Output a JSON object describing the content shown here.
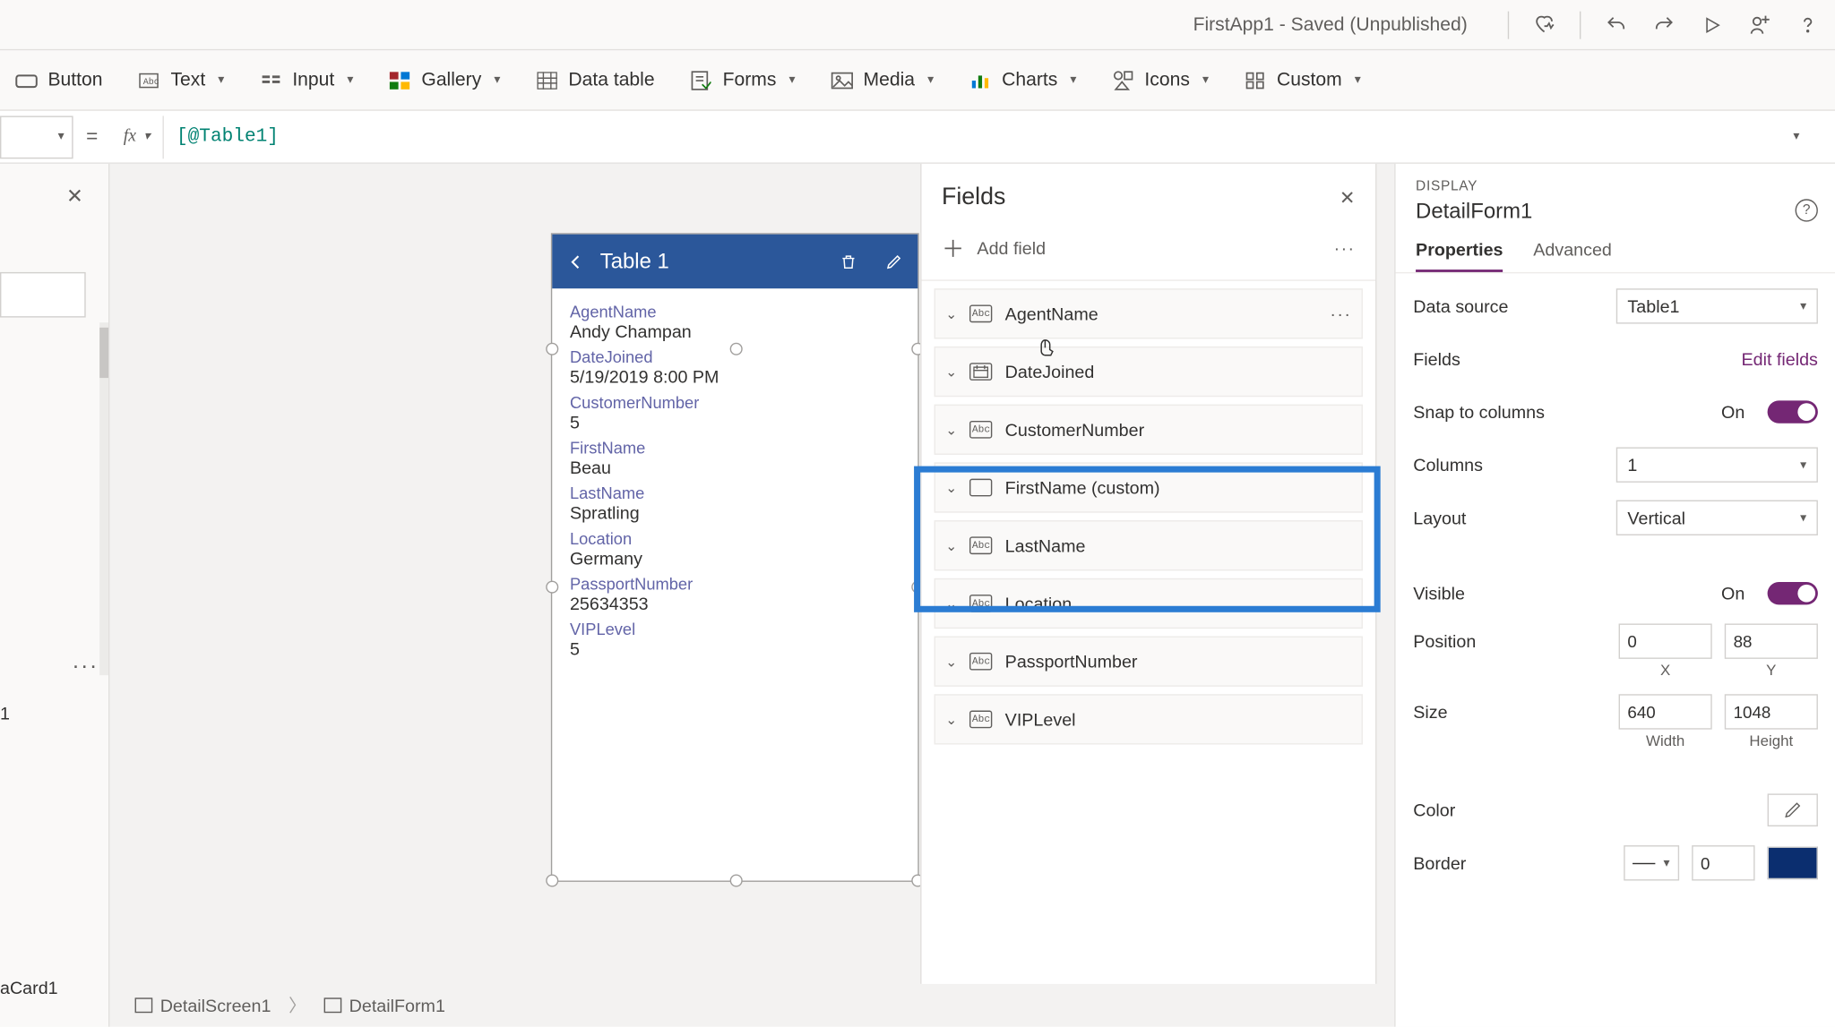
{
  "titlebar": {
    "app_title": "FirstApp1 - Saved (Unpublished)"
  },
  "ribbon": {
    "button": "Button",
    "text": "Text",
    "input": "Input",
    "gallery": "Gallery",
    "datatable": "Data table",
    "forms": "Forms",
    "media": "Media",
    "charts": "Charts",
    "icons": "Icons",
    "custom": "Custom"
  },
  "formula": {
    "eq": "=",
    "fx": "fx",
    "value": "[@Table1]"
  },
  "left": {
    "item1": "1",
    "item2": "aCard1"
  },
  "canvas_form": {
    "title": "Table 1",
    "fields": [
      {
        "label": "AgentName",
        "value": "Andy Champan"
      },
      {
        "label": "DateJoined",
        "value": "5/19/2019 8:00 PM"
      },
      {
        "label": "CustomerNumber",
        "value": "5"
      },
      {
        "label": "FirstName",
        "value": "Beau"
      },
      {
        "label": "LastName",
        "value": "Spratling"
      },
      {
        "label": "Location",
        "value": "Germany"
      },
      {
        "label": "PassportNumber",
        "value": "25634353"
      },
      {
        "label": "VIPLevel",
        "value": "5"
      }
    ]
  },
  "breadcrumbs": {
    "a": "DetailScreen1",
    "b": "DetailForm1"
  },
  "fields_panel": {
    "title": "Fields",
    "add": "Add field",
    "items": [
      {
        "name": "AgentName",
        "icon": "Abc",
        "dots": true
      },
      {
        "name": "DateJoined",
        "icon": "cal"
      },
      {
        "name": "CustomerNumber",
        "icon": "Abc"
      },
      {
        "name": "FirstName (custom)",
        "icon": "box"
      },
      {
        "name": "LastName",
        "icon": "Abc"
      },
      {
        "name": "Location",
        "icon": "Abc"
      },
      {
        "name": "PassportNumber",
        "icon": "Abc"
      },
      {
        "name": "VIPLevel",
        "icon": "Abc"
      }
    ]
  },
  "props": {
    "display": "DISPLAY",
    "name": "DetailForm1",
    "tabs": {
      "properties": "Properties",
      "advanced": "Advanced"
    },
    "datasource_lbl": "Data source",
    "datasource_val": "Table1",
    "fields_lbl": "Fields",
    "edit_fields": "Edit fields",
    "snap_lbl": "Snap to columns",
    "snap_val": "On",
    "columns_lbl": "Columns",
    "columns_val": "1",
    "layout_lbl": "Layout",
    "layout_val": "Vertical",
    "visible_lbl": "Visible",
    "visible_val": "On",
    "position_lbl": "Position",
    "pos_x": "0",
    "pos_y": "88",
    "pos_xl": "X",
    "pos_yl": "Y",
    "size_lbl": "Size",
    "size_w": "640",
    "size_h": "1048",
    "size_wl": "Width",
    "size_hl": "Height",
    "color_lbl": "Color",
    "border_lbl": "Border",
    "border_w": "0"
  }
}
